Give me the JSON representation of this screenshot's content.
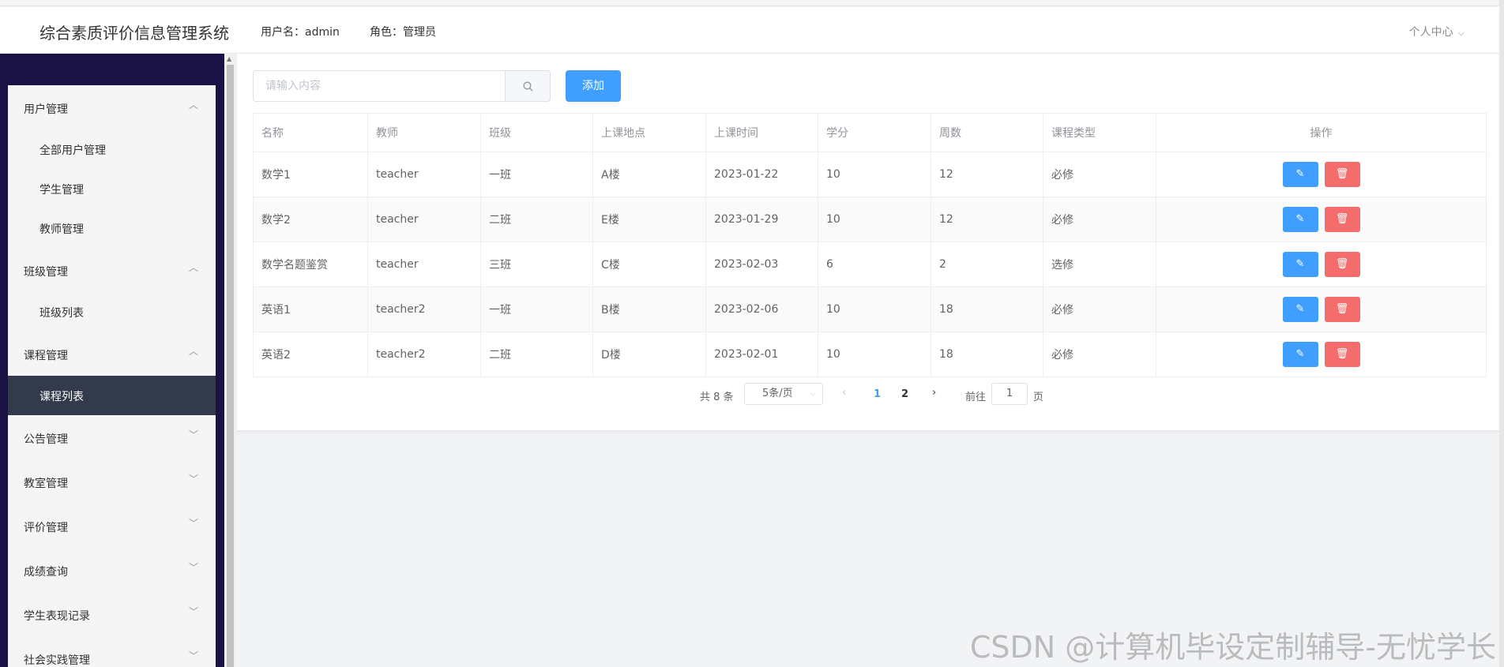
{
  "header": {
    "app_title": "综合素质评价信息管理系统",
    "username": "用户名：admin",
    "role": "角色：管理员",
    "personal_center": "个人中心"
  },
  "sidebar": {
    "groups": [
      {
        "label": "用户管理",
        "expanded": true,
        "items": [
          "全部用户管理",
          "学生管理",
          "教师管理"
        ]
      },
      {
        "label": "班级管理",
        "expanded": true,
        "items": [
          "班级列表"
        ]
      },
      {
        "label": "课程管理",
        "expanded": true,
        "items": [
          "课程列表"
        ],
        "active_item": "课程列表"
      },
      {
        "label": "公告管理",
        "expanded": false
      },
      {
        "label": "教室管理",
        "expanded": false
      },
      {
        "label": "评价管理",
        "expanded": false
      },
      {
        "label": "成绩查询",
        "expanded": false
      },
      {
        "label": "学生表现记录",
        "expanded": false
      },
      {
        "label": "社会实践管理",
        "expanded": false
      }
    ]
  },
  "toolbar": {
    "search_placeholder": "请输入内容",
    "add_label": "添加"
  },
  "table": {
    "columns": [
      "名称",
      "教师",
      "班级",
      "上课地点",
      "上课时间",
      "学分",
      "周数",
      "课程类型",
      "操作"
    ],
    "rows": [
      [
        "数学1",
        "teacher",
        "一班",
        "A楼",
        "2023-01-22",
        "10",
        "12",
        "必修"
      ],
      [
        "数学2",
        "teacher",
        "二班",
        "E楼",
        "2023-01-29",
        "10",
        "12",
        "必修"
      ],
      [
        "数学名题鉴赏",
        "teacher",
        "三班",
        "C楼",
        "2023-02-03",
        "6",
        "2",
        "选修"
      ],
      [
        "英语1",
        "teacher2",
        "一班",
        "B楼",
        "2023-02-06",
        "10",
        "18",
        "必修"
      ],
      [
        "英语2",
        "teacher2",
        "二班",
        "D楼",
        "2023-02-01",
        "10",
        "18",
        "必修"
      ]
    ]
  },
  "pagination": {
    "total": "共 8 条",
    "page_size": "5条/页",
    "pages": [
      "1",
      "2"
    ],
    "current_page": "1",
    "goto_label": "前往",
    "goto_value": "1",
    "page_unit": "页"
  },
  "watermark": "CSDN @计算机毕设定制辅导-无忧学长",
  "colors": {
    "primary": "#409eff",
    "danger": "#f56c6c",
    "sidebar_bg": "#1a1145",
    "active_menu": "#323a4c"
  },
  "icons": {
    "search": "search-icon",
    "edit": "edit-icon",
    "delete": "delete-icon",
    "chevron_up": "chevron-up-icon",
    "chevron_down": "chevron-down-icon",
    "prev": "chevron-left-icon",
    "next": "chevron-right-icon"
  }
}
